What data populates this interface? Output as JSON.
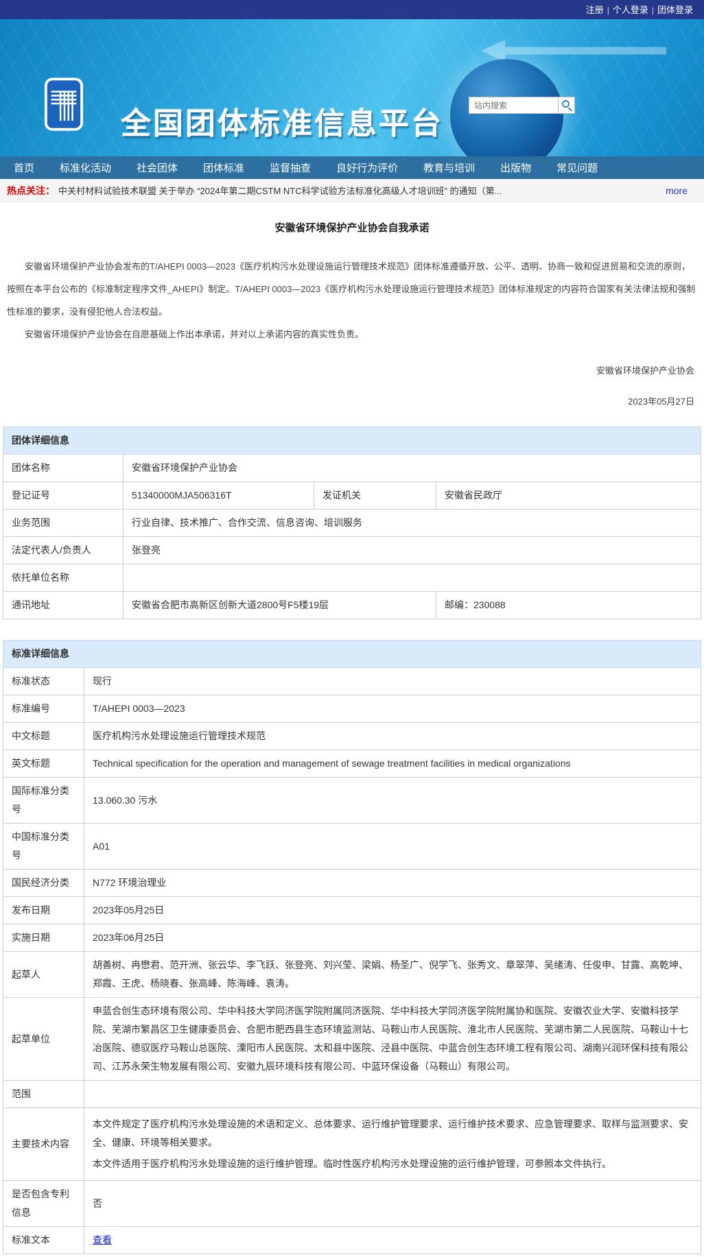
{
  "topbar": {
    "separator": "|",
    "links": [
      "注册",
      "个人登录",
      "团体登录"
    ]
  },
  "header": {
    "site_title": "全国团体标准信息平台",
    "search_placeholder": "站内搜索",
    "logo_icon": "platform-emblem"
  },
  "nav": {
    "items": [
      "首页",
      "标准化活动",
      "社会团体",
      "团体标准",
      "监督抽查",
      "良好行为评价",
      "教育与培训",
      "出版物",
      "常见问题"
    ]
  },
  "hot_news": {
    "label": "热点关注：",
    "headline": "中关村材料试验技术联盟 关于举办 “2024年第二期CSTM NTC科学试验方法标准化高级人才培训班” 的通知（第...",
    "more_label": "more"
  },
  "commitment": {
    "title": "安徽省环境保护产业协会自我承诺",
    "paragraphs": [
      "安徽省环境保护产业协会发布的T/AHEPI 0003—2023《医疗机构污水处理设施运行管理技术规范》团体标准遵循开放、公平、透明、协商一致和促进贸易和交流的原则，按照在本平台公布的《标准制定程序文件_AHEPI》制定。T/AHEPI 0003—2023《医疗机构污水处理设施运行管理技术规范》团体标准规定的内容符合国家有关法律法规和强制性标准的要求，没有侵犯他人合法权益。",
      "安徽省环境保护产业协会在自愿基础上作出本承诺，并对以上承诺内容的真实性负责。"
    ],
    "signature": "安徽省环境保护产业协会",
    "date": "2023年05月27日"
  },
  "group_info": {
    "title": "团体详细信息",
    "name_label": "团体名称",
    "name_value": "安徽省环境保护产业协会",
    "reg_label": "登记证号",
    "reg_value": "51340000MJA506316T",
    "issuer_label": "发证机关",
    "issuer_value": "安徽省民政厅",
    "scope_label": "业务范围",
    "scope_value": "行业自律、技术推广、合作交流、信息咨询、培训服务",
    "legal_label": "法定代表人/负责人",
    "legal_value": "张登亮",
    "depend_label": "依托单位名称",
    "depend_value": "",
    "addr_label": "通讯地址",
    "addr_value": "安徽省合肥市高新区创新大道2800号F5楼19层",
    "postcode_value": "邮编：230088"
  },
  "standard_info": {
    "title": "标准详细信息",
    "rows": [
      {
        "label": "标准状态",
        "value": "现行"
      },
      {
        "label": "标准编号",
        "value": "T/AHEPI 0003—2023"
      },
      {
        "label": "中文标题",
        "value": "医疗机构污水处理设施运行管理技术规范"
      },
      {
        "label": "英文标题",
        "value": "Technical specification for the operation and management of sewage treatment facilities in medical organizations"
      },
      {
        "label": "国际标准分类号",
        "value": "13.060.30 污水"
      },
      {
        "label": "中国标准分类号",
        "value": "A01"
      },
      {
        "label": "国民经济分类",
        "value": "N772 环境治理业"
      },
      {
        "label": "发布日期",
        "value": "2023年05月25日"
      },
      {
        "label": "实施日期",
        "value": "2023年06月25日"
      },
      {
        "label": "起草人",
        "value": "胡善树、冉懋君、范开洲、张云华、李飞跃、张登亮、刘兴莹、梁娟、杨圣广、倪学飞、张秀文、章翠萍、吴绪涛、任俊申、甘露、高乾坤、郑霞、王虎、杨晓春、张高峰、陈海峰、袁涛。"
      },
      {
        "label": "起草单位",
        "value": "申蓝合创生态环境有限公司、华中科技大学同济医学院附属同济医院、华中科技大学同济医学院附属协和医院、安徽农业大学、安徽科技学院、芜湖市繁昌区卫生健康委员会、合肥市肥西县生态环境监测站、马鞍山市人民医院、淮北市人民医院、芜湖市第二人民医院、马鞍山十七冶医院、德驭医疗马鞍山总医院、溧阳市人民医院、太和县中医院、泾县中医院、中蓝合创生态环境工程有限公司、湖南兴润环保科技有限公司、江苏永荣生物发展有限公司、安徽九辰环境科技有限公司、中蓝环保设备（马鞍山）有限公司。"
      },
      {
        "label": "范围",
        "value": ""
      },
      {
        "label": "主要技术内容",
        "value": [
          "本文件规定了医疗机构污水处理设施的术语和定义、总体要求、运行维护管理要求、运行维护技术要求、应急管理要求、取样与监测要求、安全、健康、环境等相关要求。",
          "本文件适用于医疗机构污水处理设施的运行维护管理。临时性医疗机构污水处理设施的运行维护管理，可参照本文件执行。"
        ]
      },
      {
        "label": "是否包含专利信息",
        "value": "否"
      },
      {
        "label": "标准文本",
        "value": "查看",
        "link": true
      }
    ]
  },
  "colors": {
    "topbar_bg": "#26388c",
    "banner_blue": "#2aa5dd",
    "nav_bg": "#2d6fa0",
    "section_header_bg": "#d9eafb",
    "hot_label_red": "#e10000",
    "link_blue": "#1220cf"
  }
}
